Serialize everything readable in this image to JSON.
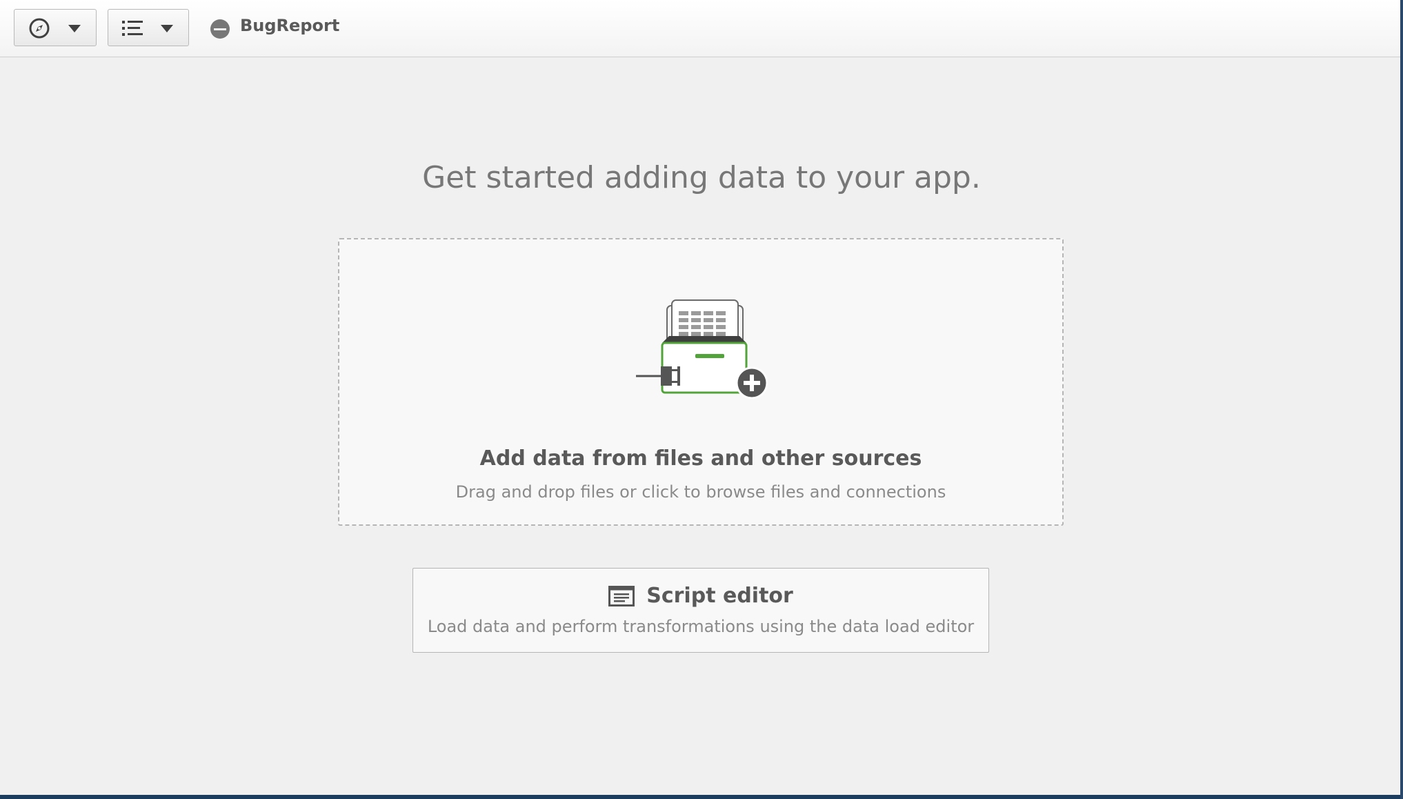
{
  "toolbar": {
    "navigation_icon": "compass-icon",
    "sheets_icon": "list-icon",
    "dropdown_icon": "caret-down-icon",
    "app_icon": "app-icon",
    "app_title": "BugReport"
  },
  "main": {
    "heading": "Get started adding data to your app.",
    "add_data": {
      "illustration": "add-data-illustration",
      "title": "Add data from files and other sources",
      "subtitle": "Drag and drop files or click to browse files and connections"
    },
    "script_editor": {
      "icon": "script-editor-icon",
      "title": "Script editor",
      "subtitle": "Load data and perform transformations using the data load editor"
    }
  },
  "colors": {
    "accent_green": "#52a33a",
    "text_dark": "#595959",
    "text_muted": "#8a8a8a"
  }
}
